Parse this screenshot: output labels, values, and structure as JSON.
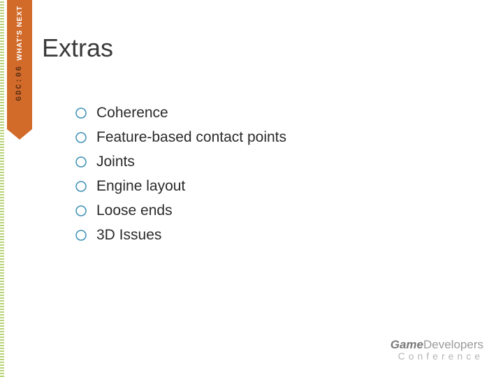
{
  "ribbon": {
    "text_primary": "WHAT'S NEXT",
    "text_secondary": "GDC:06"
  },
  "title": "Extras",
  "bullets": [
    "Coherence",
    "Feature-based contact points",
    "Joints",
    "Engine layout",
    "Loose ends",
    "3D Issues"
  ],
  "footer": {
    "game": "Game",
    "developers": "Developers",
    "conference": "Conference"
  }
}
